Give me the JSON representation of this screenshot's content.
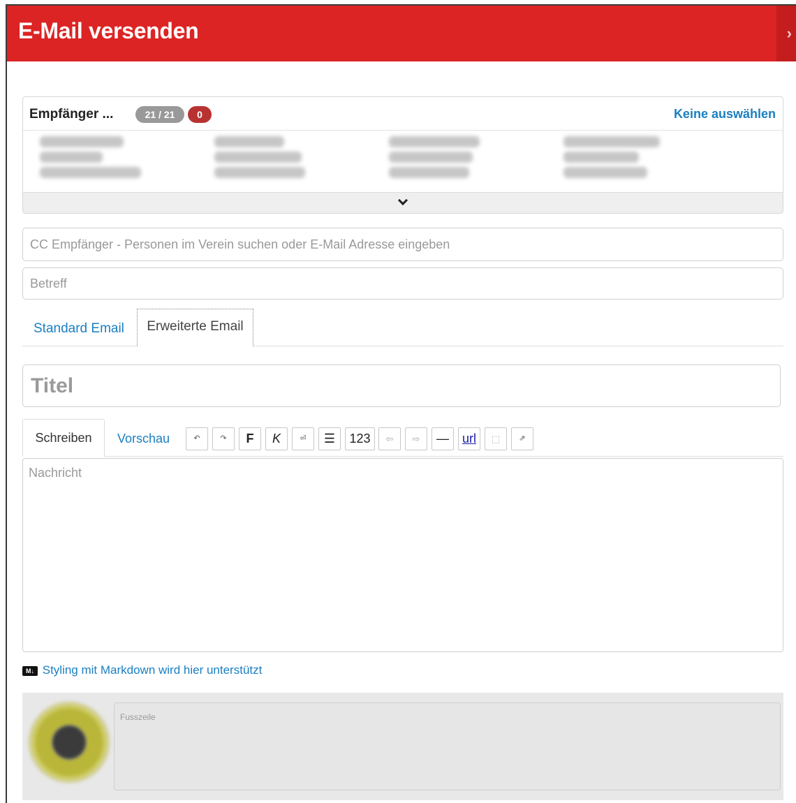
{
  "header": {
    "title": "E-Mail versenden",
    "close_icon": "chevron-right-icon"
  },
  "recipients": {
    "title": "Empfänger ...",
    "count": "21 / 21",
    "error_count": "0",
    "deselect_all": "Keine auswählen",
    "expand_icon": "chevron-down-icon"
  },
  "cc": {
    "placeholder": "CC Empfänger - Personen im Verein suchen oder E-Mail Adresse eingeben"
  },
  "subject": {
    "placeholder": "Betreff"
  },
  "mail_tabs": {
    "standard": "Standard Email",
    "extended": "Erweiterte Email"
  },
  "title_field": {
    "placeholder": "Titel"
  },
  "editor_tabs": {
    "write": "Schreiben",
    "preview": "Vorschau"
  },
  "toolbar": {
    "undo": "↶",
    "redo": "↷",
    "bold": "F",
    "italic": "K",
    "newline": "⏎",
    "list": "☰",
    "numbered": "123",
    "outdent": "⇦",
    "indent": "⇨",
    "hr": "—",
    "url": "url",
    "image": "⬚",
    "clear": "⇗"
  },
  "message": {
    "placeholder": "Nachricht"
  },
  "markdown": {
    "badge": "M↓",
    "note": "Styling mit Markdown wird hier unterstützt"
  },
  "footer": {
    "placeholder": "Fusszeile"
  }
}
